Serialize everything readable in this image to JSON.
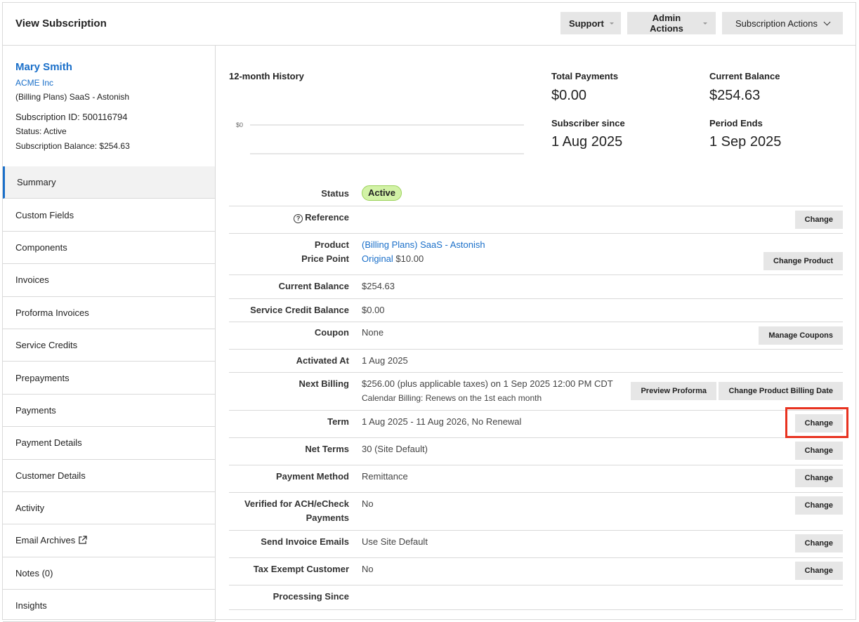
{
  "header": {
    "title": "View Subscription",
    "support_label": "Support",
    "admin_label": "Admin Actions",
    "subscription_actions_label": "Subscription Actions"
  },
  "customer": {
    "name": "Mary Smith",
    "org": "ACME Inc",
    "plan": "(Billing Plans) SaaS - Astonish",
    "subscription_id": "Subscription ID: 500116794",
    "status": "Status: Active",
    "balance": "Subscription Balance: $254.63"
  },
  "nav": [
    "Summary",
    "Custom Fields",
    "Components",
    "Invoices",
    "Proforma Invoices",
    "Service Credits",
    "Prepayments",
    "Payments",
    "Payment Details",
    "Customer Details",
    "Activity",
    "Email Archives",
    "Notes (0)",
    "Insights"
  ],
  "history": {
    "title": "12-month History",
    "y_tick": "$0"
  },
  "chart_data": {
    "type": "line",
    "title": "12-month History",
    "y_ticks": [
      "$0"
    ],
    "series": []
  },
  "stats": {
    "total_payments_label": "Total Payments",
    "total_payments": "$0.00",
    "current_balance_label": "Current Balance",
    "current_balance": "$254.63",
    "subscriber_since_label": "Subscriber since",
    "subscriber_since": "1 Aug 2025",
    "period_ends_label": "Period Ends",
    "period_ends": "1 Sep 2025"
  },
  "details": {
    "status_label": "Status",
    "status_value": "Active",
    "reference_label": "Reference",
    "product_label": "Product",
    "product_value": "(Billing Plans) SaaS - Astonish",
    "price_point_label": "Price Point",
    "price_point_link": "Original",
    "price_point_amount": "$10.00",
    "current_balance_label": "Current Balance",
    "current_balance_value": "$254.63",
    "service_credit_label": "Service Credit Balance",
    "service_credit_value": "$0.00",
    "coupon_label": "Coupon",
    "coupon_value": "None",
    "activated_label": "Activated At",
    "activated_value": "1 Aug 2025",
    "next_billing_label": "Next Billing",
    "next_billing_value": "$256.00 (plus applicable taxes) on 1 Sep 2025 12:00 PM CDT",
    "next_billing_sub": "Calendar Billing: Renews on the 1st each month",
    "term_label": "Term",
    "term_value": "1 Aug 2025 - 11 Aug 2026, No Renewal",
    "net_terms_label": "Net Terms",
    "net_terms_value": "30 (Site Default)",
    "payment_method_label": "Payment Method",
    "payment_method_value": "Remittance",
    "verified_label_1": "Verified for ACH/eCheck",
    "verified_label_2": "Payments",
    "verified_value": "No",
    "send_invoice_label": "Send Invoice Emails",
    "send_invoice_value": "Use Site Default",
    "tax_exempt_label": "Tax Exempt Customer",
    "tax_exempt_value": "No",
    "processing_label": "Processing Since"
  },
  "buttons": {
    "change": "Change",
    "change_product": "Change Product",
    "manage_coupons": "Manage Coupons",
    "preview_proforma": "Preview Proforma",
    "change_billing_date": "Change Product Billing Date"
  },
  "colors": {
    "link": "#1a6fc9",
    "highlight": "#e8321f",
    "active_badge": "#d2f2a6"
  }
}
